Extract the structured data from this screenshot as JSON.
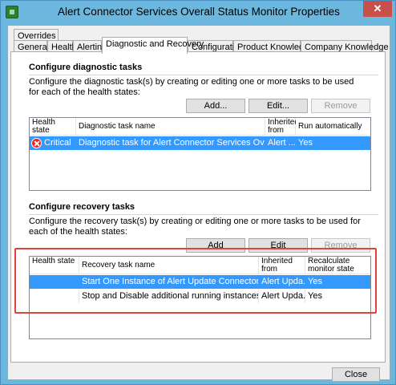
{
  "window": {
    "title": "Alert Connector Services Overall Status Monitor Properties",
    "close_glyph": "✕"
  },
  "tabs_row1": [
    {
      "label": "Overrides"
    }
  ],
  "tabs_row2": [
    {
      "label": "General"
    },
    {
      "label": "Health"
    },
    {
      "label": "Alerting"
    },
    {
      "label": "Diagnostic and Recovery",
      "active": true
    },
    {
      "label": "Configuration"
    },
    {
      "label": "Product Knowledge"
    },
    {
      "label": "Company Knowledge"
    }
  ],
  "diagnostic": {
    "title": "Configure diagnostic tasks",
    "description": "Configure the diagnostic task(s) by creating or editing one or more tasks to be used for each of the health states:",
    "buttons": {
      "add": "Add...",
      "edit": "Edit...",
      "remove": "Remove"
    },
    "columns": {
      "health": "Health state",
      "name": "Diagnostic task name",
      "inherited": "Inherited from",
      "run": "Run automatically"
    },
    "rows": [
      {
        "health": "Critical",
        "name": "Diagnostic task for Alert Connector Services Overall Statu...",
        "inherited": "Alert ...",
        "run": "Yes",
        "selected": true
      }
    ]
  },
  "recovery": {
    "title": "Configure recovery tasks",
    "description": "Configure the recovery task(s) by creating or editing one or more tasks to be used for each of the health states:",
    "buttons": {
      "add": "Add",
      "edit": "Edit",
      "remove": "Remove"
    },
    "columns": {
      "health": "Health state",
      "name": "Recovery task name",
      "inherited": "Inherited from",
      "recalc": "Recalculate monitor state"
    },
    "rows": [
      {
        "health": "",
        "name": "Start One Instance of Alert Update Connector Service",
        "inherited": "Alert Upda...",
        "recalc": "Yes",
        "selected": true
      },
      {
        "health": "",
        "name": "Stop and Disable additional running instances",
        "inherited": "Alert Upda...",
        "recalc": "Yes",
        "selected": false
      }
    ]
  },
  "footer": {
    "close": "Close"
  },
  "colors": {
    "selection": "#3399ff",
    "highlight": "#e0453b",
    "title_bar": "#6bb7de"
  }
}
